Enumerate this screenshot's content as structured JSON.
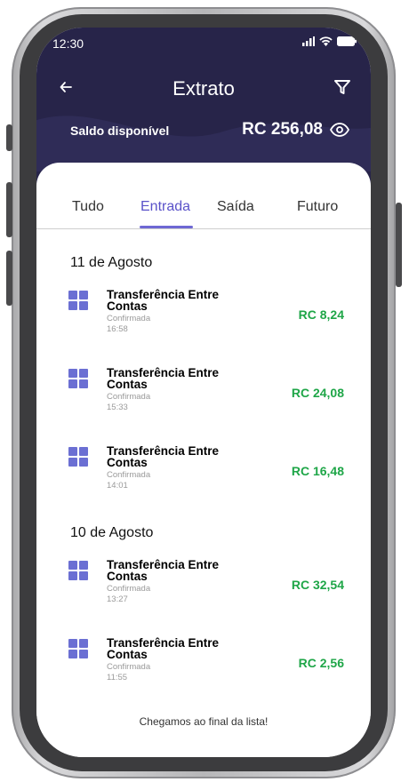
{
  "status_bar": {
    "time": "12:30"
  },
  "header": {
    "back_icon": "arrow-left-icon",
    "title": "Extrato",
    "filter_icon": "filter-icon",
    "balance_label": "Saldo disponível",
    "balance_value": "RC 256,08",
    "eye_icon": "eye-icon"
  },
  "tabs": [
    {
      "label": "Tudo",
      "active": false
    },
    {
      "label": "Entrada",
      "active": true
    },
    {
      "label": "Saída",
      "active": false
    },
    {
      "label": "Futuro",
      "active": false
    }
  ],
  "groups": [
    {
      "date": "11 de Agosto",
      "items": [
        {
          "title": "Transferência Entre Contas",
          "status": "Confirmada",
          "time": "16:58",
          "amount": "RC 8,24"
        },
        {
          "title": "Transferência Entre Contas",
          "status": "Confirmada",
          "time": "15:33",
          "amount": "RC 24,08"
        },
        {
          "title": "Transferência Entre Contas",
          "status": "Confirmada",
          "time": "14:01",
          "amount": "RC 16,48"
        }
      ]
    },
    {
      "date": "10 de Agosto",
      "items": [
        {
          "title": "Transferência Entre Contas",
          "status": "Confirmada",
          "time": "13:27",
          "amount": "RC 32,54"
        },
        {
          "title": "Transferência Entre Contas",
          "status": "Confirmada",
          "time": "11:55",
          "amount": "RC 2,56"
        }
      ]
    }
  ],
  "footer_message": "Chegamos ao final da lista!",
  "colors": {
    "header_bg": "#272449",
    "accent": "#6e68d4",
    "amount_green": "#1fa648",
    "icon_purple": "#6b6fd3"
  }
}
